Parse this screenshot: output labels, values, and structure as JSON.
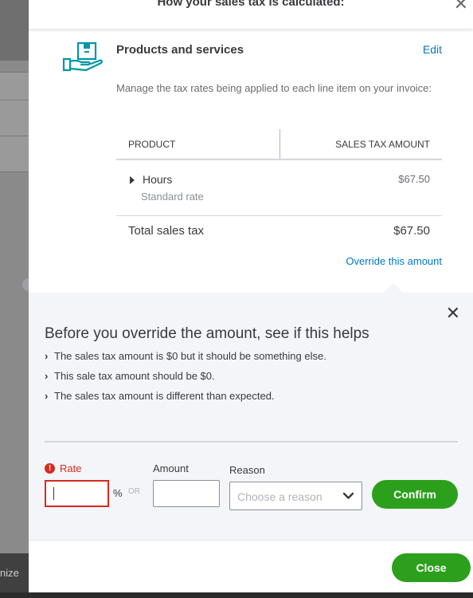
{
  "panel": {
    "title": "How your sales tax is calculated:",
    "close_icon": "close-icon"
  },
  "background": {
    "footer_text": "nize"
  },
  "products": {
    "icon": "box-in-hand-icon",
    "title": "Products and services",
    "edit_label": "Edit",
    "description": "Manage the tax rates being applied to each line item on your invoice:",
    "table": {
      "headers": [
        "PRODUCT",
        "SALES TAX AMOUNT"
      ],
      "rows": [
        {
          "name": "Hours",
          "rate": "Standard rate",
          "amount": "$67.50"
        }
      ],
      "total_label": "Total sales tax",
      "total_amount": "$67.50"
    },
    "override_label": "Override this amount"
  },
  "override": {
    "heading": "Before you override the amount, see if this helps",
    "items": [
      "The sales tax amount is $0 but it should be something else.",
      "This sale tax amount should be $0.",
      "The sales tax amount is different than expected."
    ],
    "rate_label": "Rate",
    "rate_value": "",
    "percent": "%",
    "or_label": "OR",
    "amount_label": "Amount",
    "amount_value": "",
    "reason_label": "Reason",
    "reason_placeholder": "Choose a reason",
    "confirm_label": "Confirm"
  },
  "footer": {
    "close_label": "Close"
  },
  "colors": {
    "accent_green": "#2ca01c",
    "link_blue": "#0077c5",
    "error_red": "#d52b1e",
    "icon_teal": "#0097a7"
  }
}
